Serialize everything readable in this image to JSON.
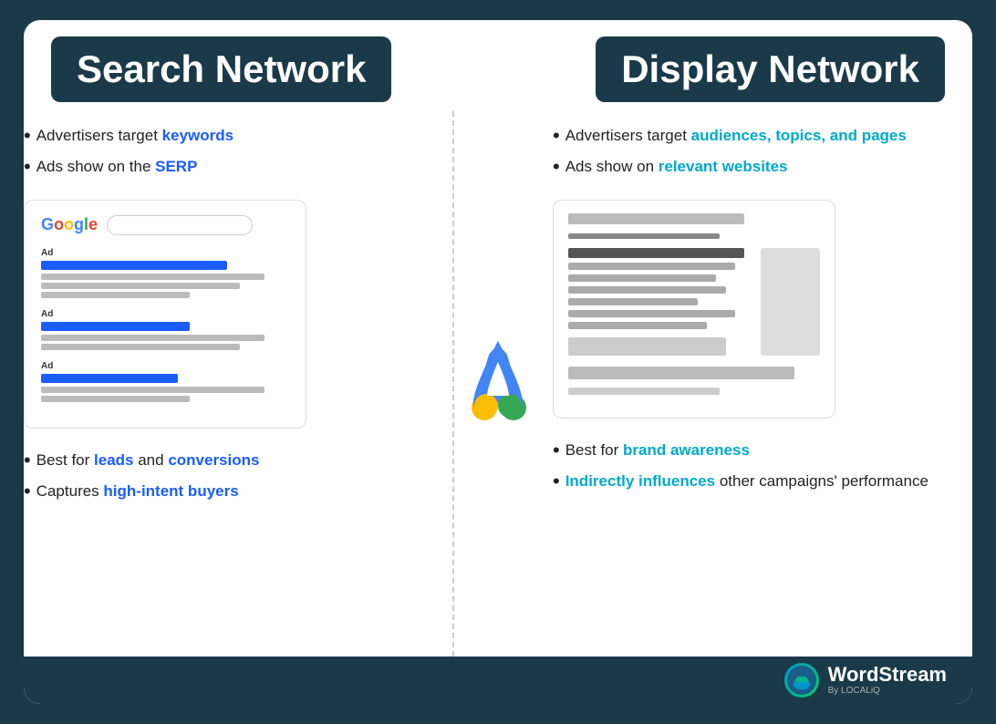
{
  "header": {
    "search_title": "Search Network",
    "display_title": "Display Network"
  },
  "search": {
    "bullets": [
      {
        "prefix": "Advertisers target ",
        "highlight": "keywords",
        "suffix": ""
      },
      {
        "prefix": "Ads show on the ",
        "highlight": "SERP",
        "suffix": ""
      }
    ],
    "bottom_bullets": [
      {
        "prefix": "Best for ",
        "highlight": "leads",
        "middle": " and ",
        "highlight2": "conversions",
        "suffix": ""
      },
      {
        "prefix": "Captures ",
        "highlight": "high-intent buyers",
        "suffix": ""
      }
    ]
  },
  "display": {
    "bullets": [
      {
        "prefix": "Advertisers target ",
        "highlight": "audiences, topics, and pages",
        "suffix": ""
      },
      {
        "prefix": "Ads show on ",
        "highlight": "relevant websites",
        "suffix": ""
      }
    ],
    "bottom_bullets": [
      {
        "prefix": "Best for ",
        "highlight": "brand awareness",
        "suffix": ""
      },
      {
        "prefix": "",
        "highlight": "Indirectly influences",
        "middle": " other campaigns' performance",
        "suffix": ""
      }
    ]
  },
  "footer": {
    "brand": "WordStream",
    "sub": "By LOCALiQ"
  }
}
